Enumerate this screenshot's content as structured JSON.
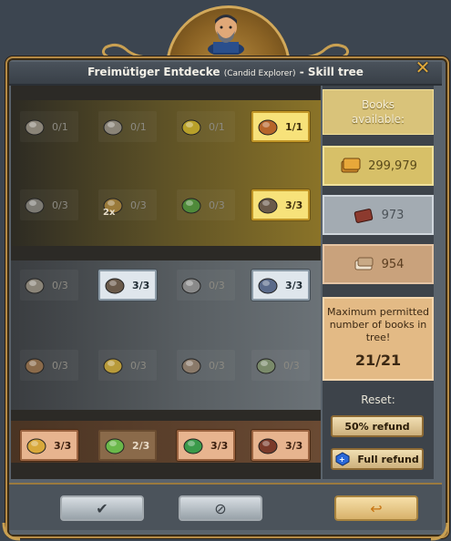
{
  "window": {
    "title_main": "Freimütiger Entdecke",
    "title_sub": "(Candid Explorer)",
    "title_suffix": " - Skill tree"
  },
  "tree": {
    "row1": [
      {
        "level": "0/1",
        "icon": "cart-icon",
        "state": "dim"
      },
      {
        "level": "0/1",
        "icon": "crate-icon",
        "state": "dim"
      },
      {
        "level": "0/1",
        "icon": "gold-coin-icon",
        "state": "dim"
      },
      {
        "level": "1/1",
        "icon": "coin-pile-icon",
        "state": "gold"
      }
    ],
    "row2": [
      {
        "level": "0/3",
        "icon": "ore-icon",
        "state": "dim"
      },
      {
        "level": "0/3",
        "icon": "double-chest-icon",
        "state": "dim",
        "badge": "2x"
      },
      {
        "level": "0/3",
        "icon": "green-gem-icon",
        "state": "dim"
      },
      {
        "level": "3/3",
        "icon": "binoculars-icon",
        "state": "gold"
      }
    ],
    "row3": [
      {
        "level": "0/3",
        "icon": "wagon-icon",
        "state": "dim"
      },
      {
        "level": "3/3",
        "icon": "shovel-icon",
        "state": "silver"
      },
      {
        "level": "0/3",
        "icon": "arrows-icon",
        "state": "dim"
      },
      {
        "level": "3/3",
        "icon": "donkey-icon",
        "state": "silver"
      }
    ],
    "row4": [
      {
        "level": "0/3",
        "icon": "logs-icon",
        "state": "dim"
      },
      {
        "level": "0/3",
        "icon": "question-mark-icon",
        "state": "dim"
      },
      {
        "level": "0/3",
        "icon": "compass-icon",
        "state": "dim"
      },
      {
        "level": "0/3",
        "icon": "egg-icon",
        "state": "dim"
      }
    ],
    "row5": [
      {
        "level": "3/3",
        "icon": "stopwatch-icon",
        "state": "bronze"
      },
      {
        "level": "2/3",
        "icon": "green-crystals-icon",
        "state": "bronze-dark"
      },
      {
        "level": "3/3",
        "icon": "emerald-icon",
        "state": "bronze"
      },
      {
        "level": "3/3",
        "icon": "boots-icon",
        "state": "bronze"
      }
    ]
  },
  "side": {
    "books_label_line1": "Books",
    "books_label_line2": "available:",
    "gold_books": "299,979",
    "silver_books": "973",
    "bronze_books": "954",
    "max_text": "Maximum permitted number of books in tree!",
    "max_value": "21/21",
    "reset_label": "Reset:",
    "refund_50": "50% refund",
    "refund_full": "Full refund"
  },
  "colors": {
    "gold_cell": "#f7e27a",
    "silver_cell": "#dfe6ec",
    "bronze_cell": "#e7b48f",
    "frame_trim": "#b58a45"
  }
}
